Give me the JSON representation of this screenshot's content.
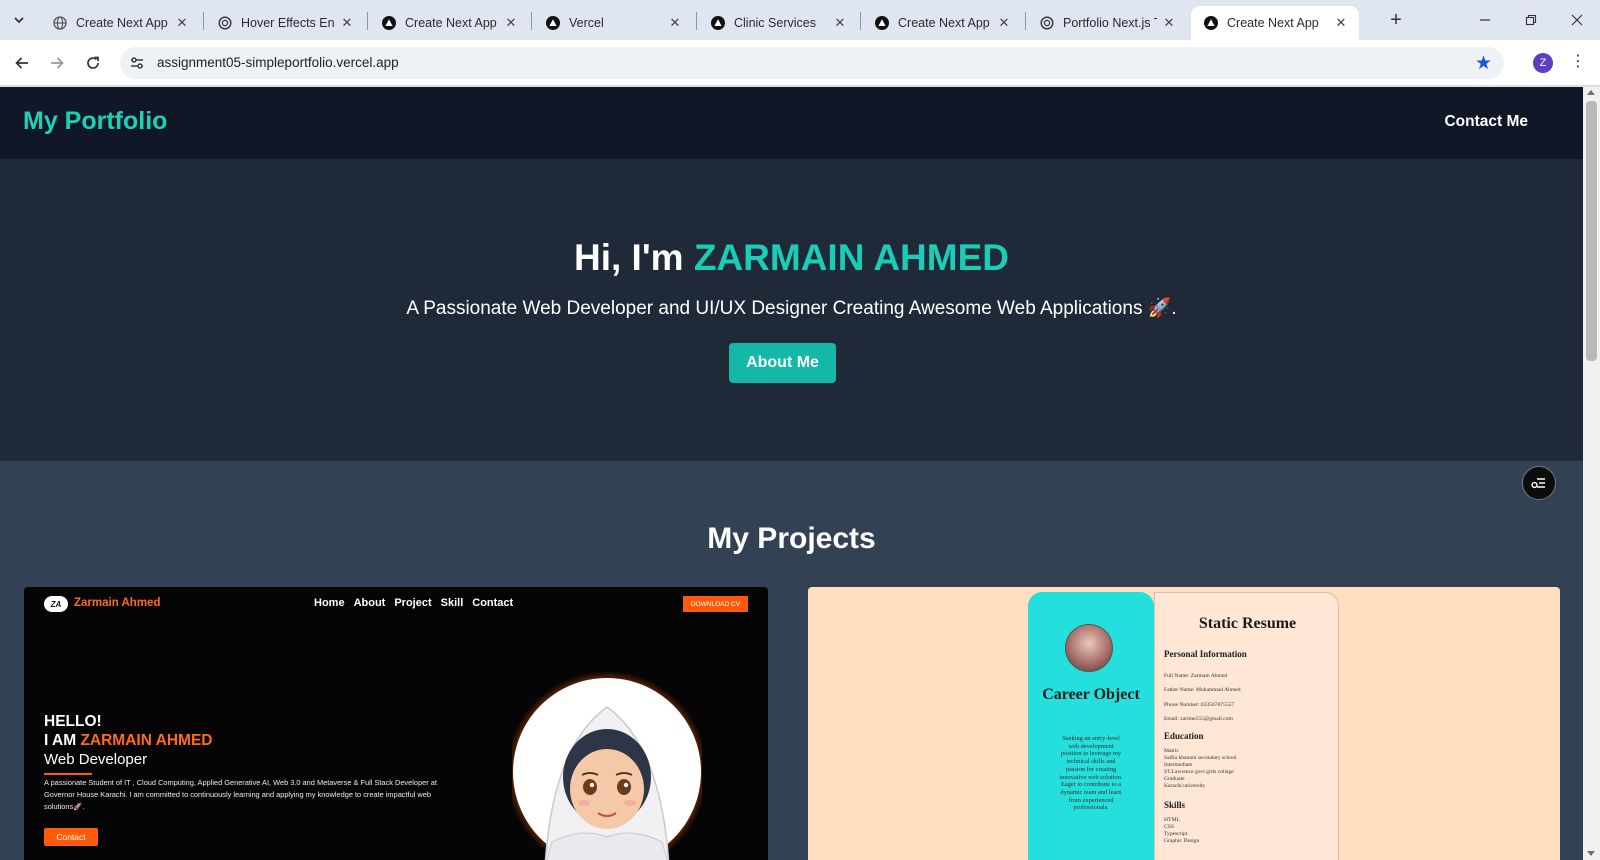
{
  "browser": {
    "tabs": [
      {
        "title": "Create Next App",
        "favicon": "globe-icon",
        "active": false
      },
      {
        "title": "Hover Effects Enha",
        "favicon": "openai-icon",
        "active": false
      },
      {
        "title": "Create Next App",
        "favicon": "vercel-icon",
        "active": false
      },
      {
        "title": "Vercel",
        "favicon": "vercel-icon",
        "active": false
      },
      {
        "title": "Clinic Services",
        "favicon": "vercel-icon",
        "active": false
      },
      {
        "title": "Create Next App",
        "favicon": "vercel-icon",
        "active": false
      },
      {
        "title": "Portfolio Next.js Te",
        "favicon": "openai-icon",
        "active": false
      },
      {
        "title": "Create Next App",
        "favicon": "vercel-icon",
        "active": true
      }
    ],
    "close_glyph": "✕",
    "new_tab_glyph": "+",
    "url": "assignment05-simpleportfolio.vercel.app",
    "profile_initial": "Z",
    "bookmark_color": "#1a56d6"
  },
  "site": {
    "brand": "My Portfolio",
    "nav_contact": "Contact Me",
    "hero": {
      "greeting": "Hi, I'm ",
      "name": "ZARMAIN AHMED",
      "tagline": "A Passionate Web Developer and UI/UX Designer Creating Awesome Web Applications 🚀.",
      "button": "About Me"
    },
    "projects_title": "My Projects",
    "colors": {
      "accent": "#19cdb6",
      "header_bg": "#101827",
      "hero_bg": "#1f2937",
      "section_bg": "#334155"
    }
  },
  "project1": {
    "logo": "ZA",
    "brand": "Zarmain Ahmed",
    "nav": [
      "Home",
      "About",
      "Project",
      "Skill",
      "Contact"
    ],
    "download": "DOWNLOAD CV",
    "hello": "HELLO!",
    "iam": "I AM ",
    "name": "ZARMAIN AHMED",
    "role": "Web Developer",
    "description": "A passionate Student of IT , Cloud Computing, Applied Generative AI, Web 3.0 and Metaverse & Full Stack Developer at Governor House Karachi. I am committed to continuously learning and applying my knowledge to create impactful web solutions🚀.",
    "contact": "Contact"
  },
  "project2": {
    "career_title": "Career Object",
    "career_text": "Seeking an entry-level web development position to leverage my technical skills and passion for creating innovative web solution. Eager to contribute to a dynamic team and learn from experienced professionals.",
    "title": "Static Resume",
    "personal_heading": "Personal Information",
    "personal": [
      "Full Name: Zarmain Ahmed",
      "Father Name: Muhammad Ahmed",
      "Phone Number: 033567875557",
      "Email: zarime555@gmail.com"
    ],
    "education_heading": "Education",
    "education": [
      "Matric",
      "Saifia khanum secondary school",
      "Intermediate",
      "ST.Lawrence govt girls collage",
      "Graduate",
      "Karachi university"
    ],
    "skills_heading": "Skills",
    "skills": [
      "HTML",
      "CSS",
      "Typescript",
      "Graphic Design"
    ]
  }
}
